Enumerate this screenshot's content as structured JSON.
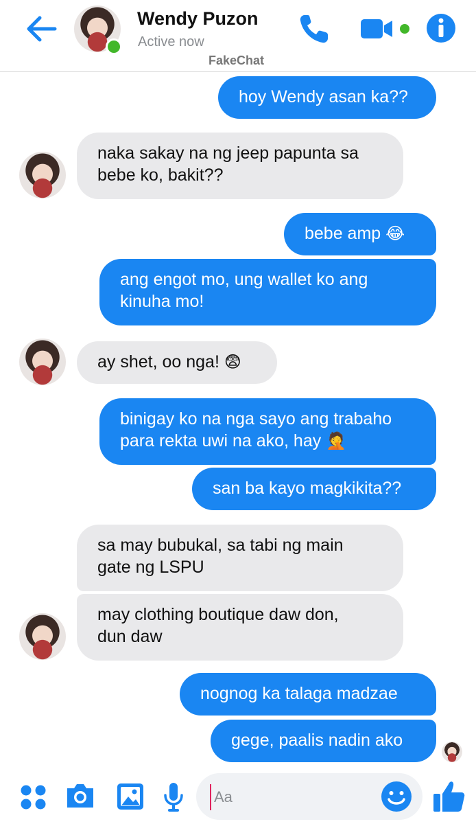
{
  "header": {
    "contact_name": "Wendy Puzon",
    "status": "Active now",
    "watermark": "FakeChat",
    "icons": [
      "back-arrow-icon",
      "phone-icon",
      "video-camera-icon",
      "info-icon"
    ]
  },
  "colors": {
    "accent": "#1a86f2",
    "incoming_bubble": "#e9e9eb",
    "presence": "#42b72a"
  },
  "messages": [
    {
      "side": "outgoing",
      "text": "hoy Wendy asan ka??"
    },
    {
      "side": "incoming",
      "lines": [
        "naka sakay na ng jeep papunta sa",
        "bebe ko, bakit??"
      ]
    },
    {
      "side": "outgoing",
      "text": "bebe amp",
      "emoji": "😂"
    },
    {
      "side": "outgoing",
      "lines": [
        "ang engot mo, ung wallet ko ang",
        "kinuha mo!"
      ]
    },
    {
      "side": "incoming",
      "text": "ay shet, oo nga!",
      "emoji": "😨"
    },
    {
      "side": "outgoing",
      "lines": [
        "binigay ko na nga sayo ang trabaho",
        "para rekta uwi na ako, hay"
      ],
      "emoji": "🤦"
    },
    {
      "side": "outgoing",
      "text": "san ba kayo magkikita??"
    },
    {
      "side": "incoming",
      "lines": [
        "sa may bubukal, sa tabi ng main",
        "gate ng LSPU"
      ]
    },
    {
      "side": "incoming",
      "lines": [
        "may clothing boutique daw don,",
        "dun daw"
      ]
    },
    {
      "side": "outgoing",
      "text": "nognog ka talaga madzae"
    },
    {
      "side": "outgoing",
      "text": "gege, paalis nadin ako"
    }
  ],
  "composer": {
    "placeholder": "Aa",
    "icons": [
      "apps-grid-icon",
      "camera-icon",
      "gallery-icon",
      "microphone-icon",
      "emoji-icon",
      "thumbs-up-icon"
    ]
  }
}
